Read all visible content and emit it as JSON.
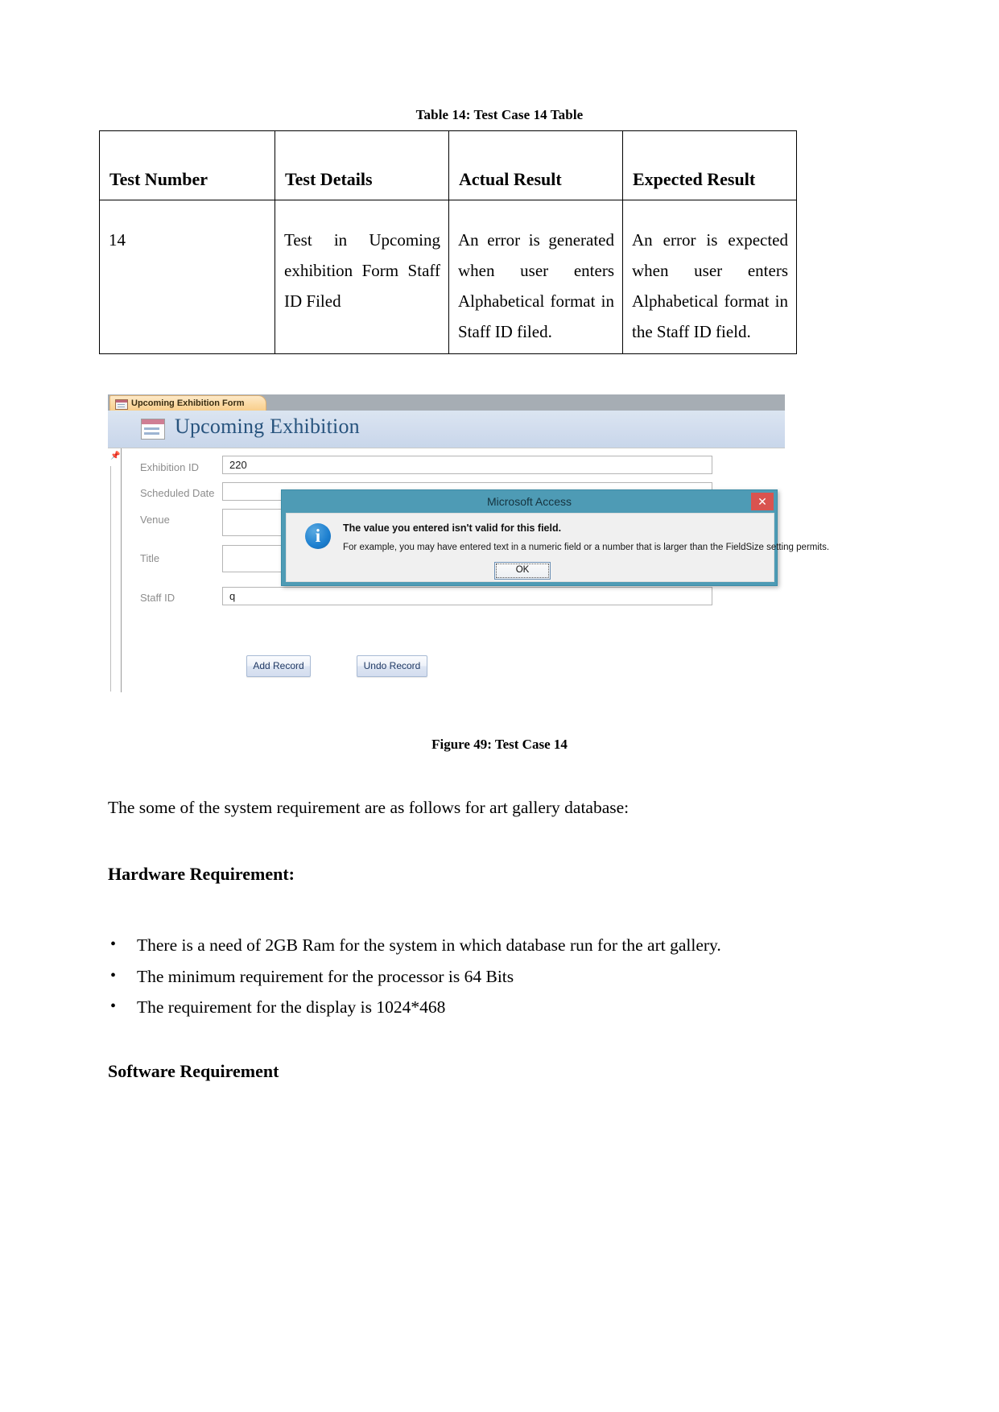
{
  "table": {
    "caption": "Table 14: Test Case 14 Table",
    "headers": [
      "Test Number",
      "Test Details",
      "Actual Result",
      "Expected Result"
    ],
    "rows": [
      {
        "test_number": "14",
        "test_details": "Test in Upcoming exhibition Form Staff ID Filed",
        "actual_result": "An error is generated when user enters Alphabetical format in Staff ID filed.",
        "expected_result": "An error is expected when user enters Alphabetical format in the Staff ID field."
      }
    ]
  },
  "screenshot": {
    "tab_label": "Upcoming Exhibition Form",
    "form_title": "Upcoming Exhibition",
    "fields": [
      {
        "label": "Exhibition ID",
        "value": "220"
      },
      {
        "label": "Scheduled Date",
        "value": ""
      },
      {
        "label": "Venue",
        "value": ""
      },
      {
        "label": "Title",
        "value": ""
      },
      {
        "label": "Staff ID",
        "value": "q"
      }
    ],
    "buttons": {
      "add_record": "Add Record",
      "undo_record": "Undo Record"
    },
    "dialog": {
      "title": "Microsoft Access",
      "close_label": "✕",
      "info_icon_glyph": "i",
      "main_message": "The value you entered isn't valid for this field.",
      "sub_message": "For example, you may have entered text in a numeric field or a number that is larger than the FieldSize setting permits.",
      "ok_label": "OK"
    },
    "colors": {
      "dialog_title_bar": "#4e9bb5",
      "close_button": "#d9534f",
      "form_header": "#d2ddee",
      "form_title_text": "#27537d",
      "tab_gradient_start": "#fde9c8",
      "info_icon": "#1c7fd0"
    }
  },
  "figure": {
    "caption": "Figure 49: Test Case 14"
  },
  "body": {
    "intro": "The some of the system requirement are as follows for art gallery database:",
    "hardware_heading": "Hardware Requirement:",
    "hardware_bullets": [
      "There is a need of 2GB Ram for the system in which database run for the art gallery.",
      "The minimum requirement for the processor is 64 Bits",
      "The requirement for the display is 1024*468"
    ],
    "software_heading": "Software Requirement"
  }
}
